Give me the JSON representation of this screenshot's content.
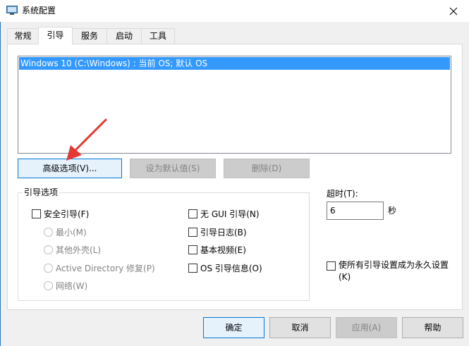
{
  "window": {
    "title": "系统配置",
    "close_icon": "close-icon"
  },
  "tabs": [
    {
      "label": "常规",
      "active": false
    },
    {
      "label": "引导",
      "active": true
    },
    {
      "label": "服务",
      "active": false
    },
    {
      "label": "启动",
      "active": false
    },
    {
      "label": "工具",
      "active": false
    }
  ],
  "boot_list": {
    "entries": [
      "Windows 10 (C:\\Windows) : 当前 OS; 默认 OS"
    ]
  },
  "entry_buttons": {
    "advanced": "高级选项(V)...",
    "set_default": "设为默认值(S)",
    "delete": "删除(D)"
  },
  "boot_options": {
    "legend": "引导选项",
    "safe_boot": "安全引导(F)",
    "minimal": "最小(M)",
    "alternate_shell": "其他外壳(L)",
    "active_directory": "Active Directory 修复(P)",
    "network": "网络(W)",
    "no_gui": "无 GUI 引导(N)",
    "boot_log": "引导日志(B)",
    "base_video": "基本视频(E)",
    "os_boot_info": "OS 引导信息(O)"
  },
  "timeout": {
    "label": "超时(T):",
    "value": "6",
    "unit": "秒"
  },
  "permanent": {
    "line1": "使所有引导设置成为永久设置",
    "line2": "(K)"
  },
  "footer": {
    "ok": "确定",
    "cancel": "取消",
    "apply": "应用(A)",
    "help": "帮助"
  },
  "colors": {
    "selection": "#3399ff",
    "annotation_arrow": "#e53935",
    "focus_border": "#0078d7"
  }
}
